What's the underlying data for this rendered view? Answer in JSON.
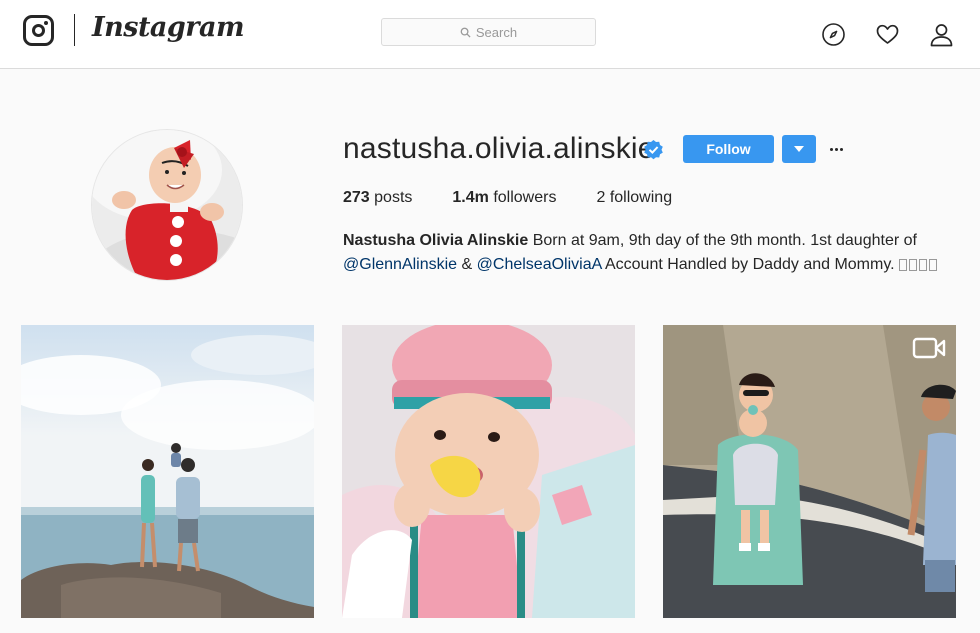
{
  "header": {
    "wordmark": "Instagram",
    "search_placeholder": "Search",
    "icons": [
      "instagram-glyph-icon",
      "explore-compass-icon",
      "heart-icon",
      "profile-person-icon"
    ]
  },
  "profile": {
    "username": "nastusha.olivia.alinskie",
    "verified": true,
    "follow_label": "Follow",
    "stats": [
      {
        "count": "273",
        "label": "posts"
      },
      {
        "count": "1.4m",
        "label": "followers"
      },
      {
        "count": "2",
        "label": "following"
      }
    ],
    "full_name": "Nastusha Olivia Alinskie",
    "bio_text_1": "Born at 9am, 9th day of the 9th month. 1st daughter of",
    "mention_1": "@GlennAlinskie",
    "bio_and": "&",
    "mention_2": "@ChelseaOliviaA",
    "bio_text_2": "Account Handled by Daddy and Mommy."
  },
  "colors": {
    "accent": "#3897f0",
    "mention": "#003569",
    "background": "#fafafa"
  },
  "posts": [
    {
      "description": "beach-family-photo",
      "video": false
    },
    {
      "description": "baby-chef-hat-photo",
      "video": false
    },
    {
      "description": "family-cliff-path-photo",
      "video": true
    }
  ]
}
